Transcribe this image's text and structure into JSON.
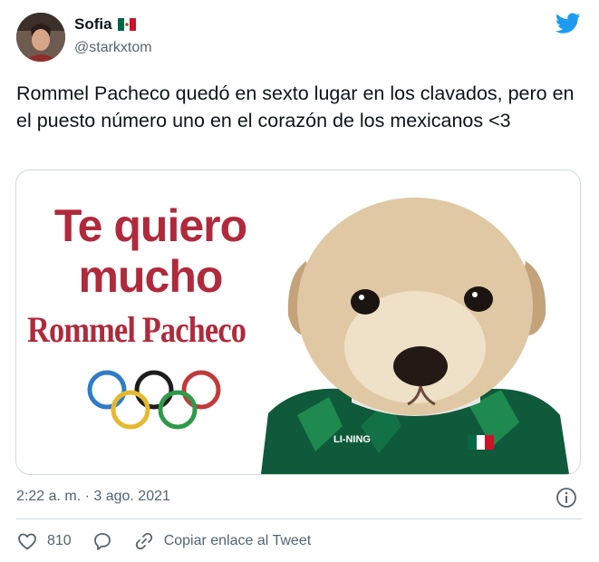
{
  "user": {
    "display_name": "Sofia",
    "handle": "@starkxtom"
  },
  "tweet": {
    "text": "Rommel Pacheco quedó en sexto lugar en los clavados, pero en el puesto número uno en el corazón de los mexicanos <3",
    "timestamp": "2:22 a. m. · 3 ago. 2021"
  },
  "media": {
    "line1": "Te quiero",
    "line2": "mucho",
    "line3": "Rommel Pacheco",
    "jersey_brand": "LI-NING"
  },
  "actions": {
    "like_count": "810",
    "copy_link_label": "Copiar enlace al Tweet"
  },
  "icons": {
    "flag": "mexico-flag-icon",
    "brand": "twitter-bird-icon",
    "info": "info-icon",
    "like": "heart-icon",
    "reply": "reply-icon",
    "link": "link-icon"
  },
  "colors": {
    "twitter_blue": "#1d9bf0",
    "meme_red": "#b02a3c",
    "jersey_green": "#0f5a3a"
  }
}
